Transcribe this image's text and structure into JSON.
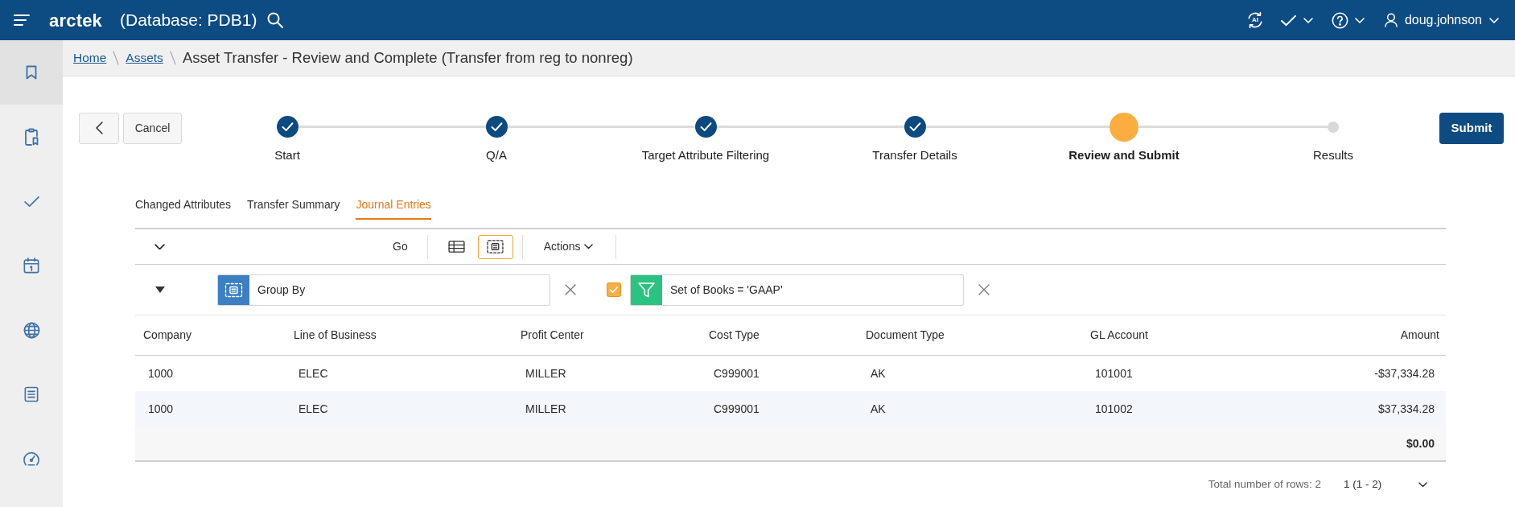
{
  "header": {
    "logo": "arctek",
    "database": "(Database: PDB1)",
    "ai_label": "AI",
    "user": "doug.johnson"
  },
  "sidebar": {
    "items": [
      {
        "selected": true
      },
      {
        "selected": false
      },
      {
        "selected": false
      },
      {
        "selected": false
      },
      {
        "selected": false
      },
      {
        "selected": false
      },
      {
        "selected": false
      }
    ]
  },
  "breadcrumb": {
    "links": [
      "Home",
      "Assets"
    ],
    "current": "Asset Transfer - Review and Complete (Transfer from reg to nonreg)"
  },
  "actions": {
    "cancel": "Cancel",
    "submit": "Submit"
  },
  "stepper": {
    "steps": [
      {
        "label": "Start",
        "completed": true,
        "current": false
      },
      {
        "label": "Q/A",
        "completed": true,
        "current": false
      },
      {
        "label": "Target Attribute Filtering",
        "completed": true,
        "current": false
      },
      {
        "label": "Transfer Details",
        "completed": true,
        "current": false
      },
      {
        "label": "Review and Submit",
        "completed": false,
        "current": true
      },
      {
        "label": "Results",
        "completed": false,
        "current": false
      }
    ]
  },
  "tabs": [
    {
      "label": "Changed Attributes",
      "selected": false
    },
    {
      "label": "Transfer Summary",
      "selected": false
    },
    {
      "label": "Journal Entries",
      "selected": true
    }
  ],
  "toolbar": {
    "go": "Go",
    "views": [
      {
        "kind": "grid",
        "selected": false
      },
      {
        "kind": "group",
        "selected": true
      }
    ],
    "actions": "Actions"
  },
  "filter_panel": {
    "expanded": true,
    "group_by": "Group By",
    "filters": [
      {
        "label": "Set of Books = 'GAAP'",
        "checked": true
      }
    ]
  },
  "table": {
    "columns": [
      "Company",
      "Line of Business",
      "Profit Center",
      "Cost Type",
      "Document Type",
      "GL Account",
      "Amount"
    ],
    "rows": [
      [
        "1000",
        "ELEC",
        "MILLER",
        "C999001",
        "AK",
        "101001",
        "-$37,334.28"
      ],
      [
        "1000",
        "ELEC",
        "MILLER",
        "C999001",
        "AK",
        "101002",
        "$37,334.28"
      ]
    ],
    "total": "$0.00"
  },
  "footer": {
    "total_rows": "Total number of rows: 2",
    "page": "1 (1 - 2)"
  }
}
